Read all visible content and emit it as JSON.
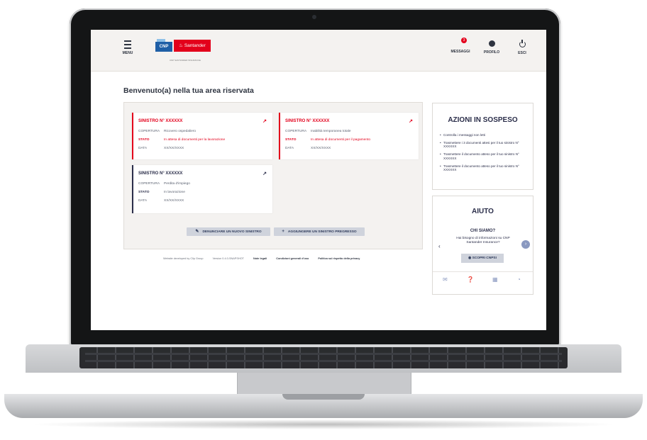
{
  "header": {
    "menu_label": "MENU",
    "logo_cnp": "CNP",
    "logo_santander": "Santander",
    "logo_subtext": "CNP SANTANDER INSURANCE",
    "nav": [
      {
        "label": "MESSAGGI",
        "icon": "envelope-icon",
        "badge": "3"
      },
      {
        "label": "PROFILO",
        "icon": "user-icon"
      },
      {
        "label": "ESCI",
        "icon": "power-icon"
      }
    ]
  },
  "main": {
    "welcome": "Benvenuto(a) nella tua area riservata",
    "claims": [
      {
        "title": "SINISTRO N° XXXXXX",
        "coverage_key": "COPERTURA",
        "coverage": "Ricovero ospedaliero",
        "status_key": "STATO",
        "status": "In attesa di documenti per la lavorazione",
        "date_key": "DATA",
        "date": "XX/XX/XXXX",
        "accent": "#e3001b"
      },
      {
        "title": "SINISTRO N° XXXXXX",
        "coverage_key": "COPERTURA",
        "coverage": "Inabilità temporanea totale",
        "status_key": "STATO",
        "status": "In attesa di documenti per il pagamento",
        "date_key": "DATA",
        "date": "XX/XX/XXXX",
        "accent": "#e3001b"
      },
      {
        "title": "SINISTRO N° XXXXXX",
        "coverage_key": "COPERTURA",
        "coverage": "Perdita d'impiego",
        "status_key": "STATO",
        "status": "In lavorazione",
        "date_key": "DATA",
        "date": "XX/XX/XXXX",
        "accent": "#2b2e4a"
      }
    ],
    "buttons": {
      "report": "DENUNCIARE UN NUOVO SINISTRO",
      "add": "AGGIUNGERE UN SINISTRO PREGRESSO"
    }
  },
  "footer": {
    "developed_by": "Website developed by Clip Group",
    "version": "Version 0.4.0-SNAPSHOT",
    "legal_notes": "Note legali",
    "terms": "Condizioni generali d'uso",
    "privacy": "Politica sul rispetto della privacy"
  },
  "sidebar": {
    "pending_title": "AZIONI IN SOSPESO",
    "pending_items": [
      "Controlla i messaggi non letti",
      "Trasmettere i 3 documenti attesi per il tuo sinistro N° XXXXXX",
      "Trasmettere il documento atteso per il tuo sinistro N° XXXXXX",
      "Trasmettere il documento atteso per il tuo sinistro N° XXXXXX"
    ],
    "help_title": "AIUTO",
    "help_question": "CHI SIAMO?",
    "help_desc": "Hai bisogno di informazioni su CNP Santander Insurance?",
    "help_button": "SCOPRI CNPSI",
    "help_icons": [
      "mail-icon",
      "question-icon",
      "book-icon",
      "globe-icon"
    ]
  },
  "colors": {
    "santander_red": "#e3001b",
    "cnp_blue": "#1f5fa6",
    "navy": "#2b2e4a"
  }
}
